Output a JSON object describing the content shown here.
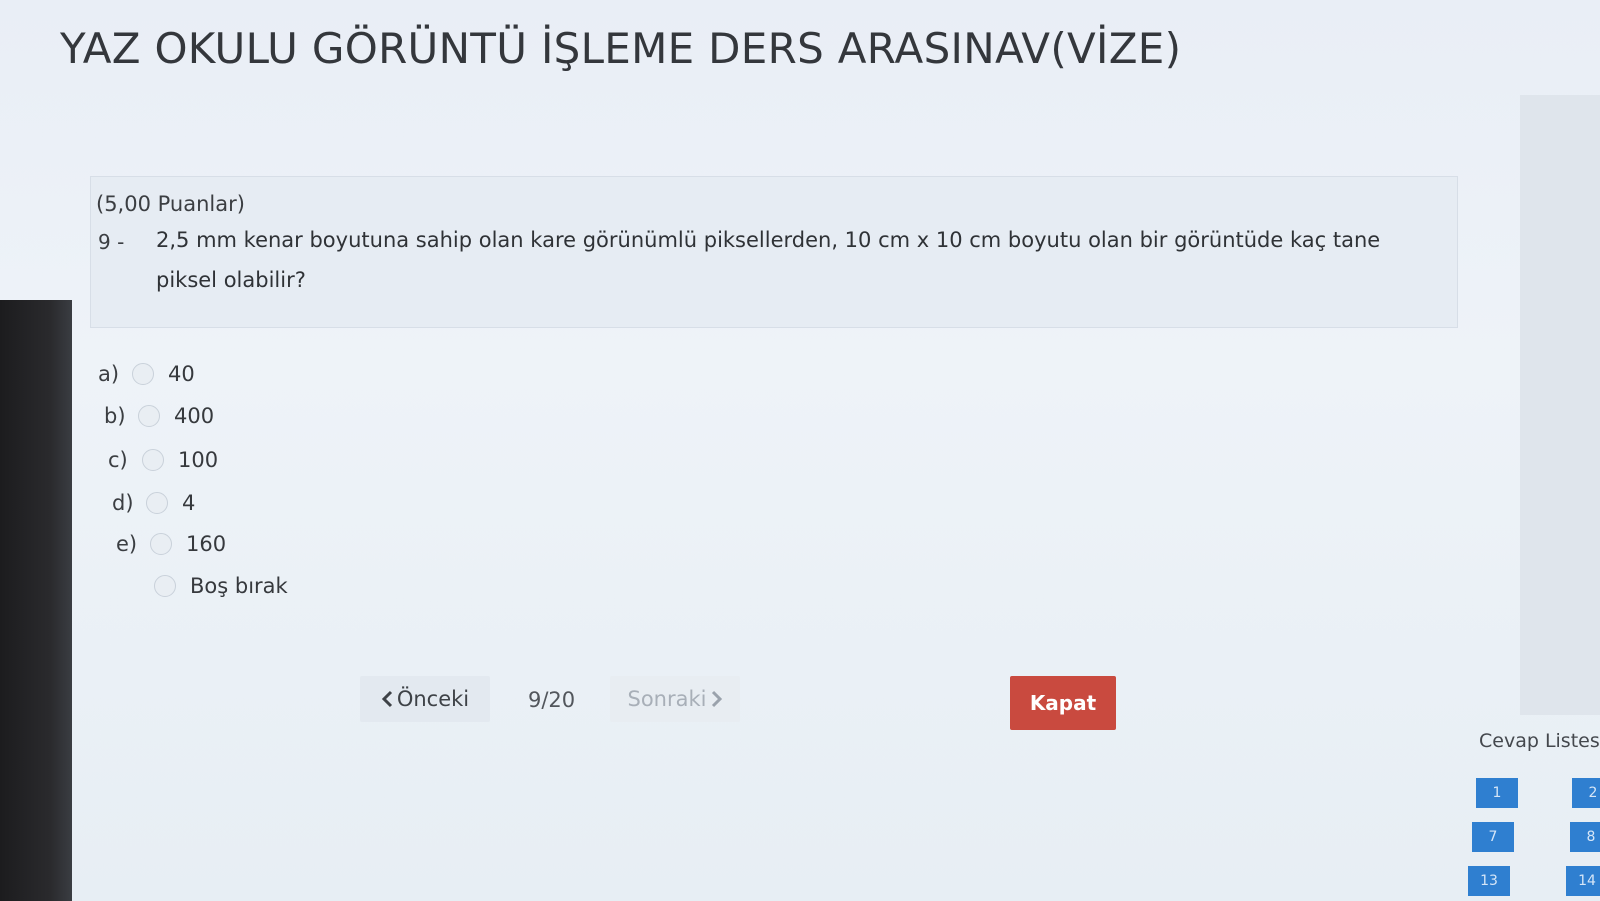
{
  "page": {
    "title": "YAZ OKULU GÖRÜNTÜ İŞLEME DERS ARASINAV(VİZE)"
  },
  "question": {
    "points": "(5,00 Puanlar)",
    "number": "9 -",
    "text": "2,5 mm kenar boyutuna sahip olan kare görünümlü piksellerden, 10 cm x 10 cm boyutu olan bir görüntüde kaç tane piksel olabilir?"
  },
  "options": [
    {
      "letter": "a)",
      "value": "40"
    },
    {
      "letter": "b)",
      "value": "400"
    },
    {
      "letter": "c)",
      "value": "100"
    },
    {
      "letter": "d)",
      "value": "4"
    },
    {
      "letter": "e)",
      "value": "160"
    },
    {
      "letter": "",
      "value": "Boş bırak"
    }
  ],
  "navigation": {
    "prev_label": "Önceki",
    "prev_icon": "chevron-left-icon",
    "counter": "9/20",
    "next_label": "Sonraki",
    "next_icon": "chevron-right-icon",
    "close_label": "Kapat"
  },
  "answer_list": {
    "title": "Cevap Listes",
    "buttons": [
      "1",
      "2",
      "7",
      "8",
      "13",
      "14"
    ]
  },
  "colors": {
    "close_button": "#c94a3f",
    "answer_button": "#2f7fd0"
  }
}
